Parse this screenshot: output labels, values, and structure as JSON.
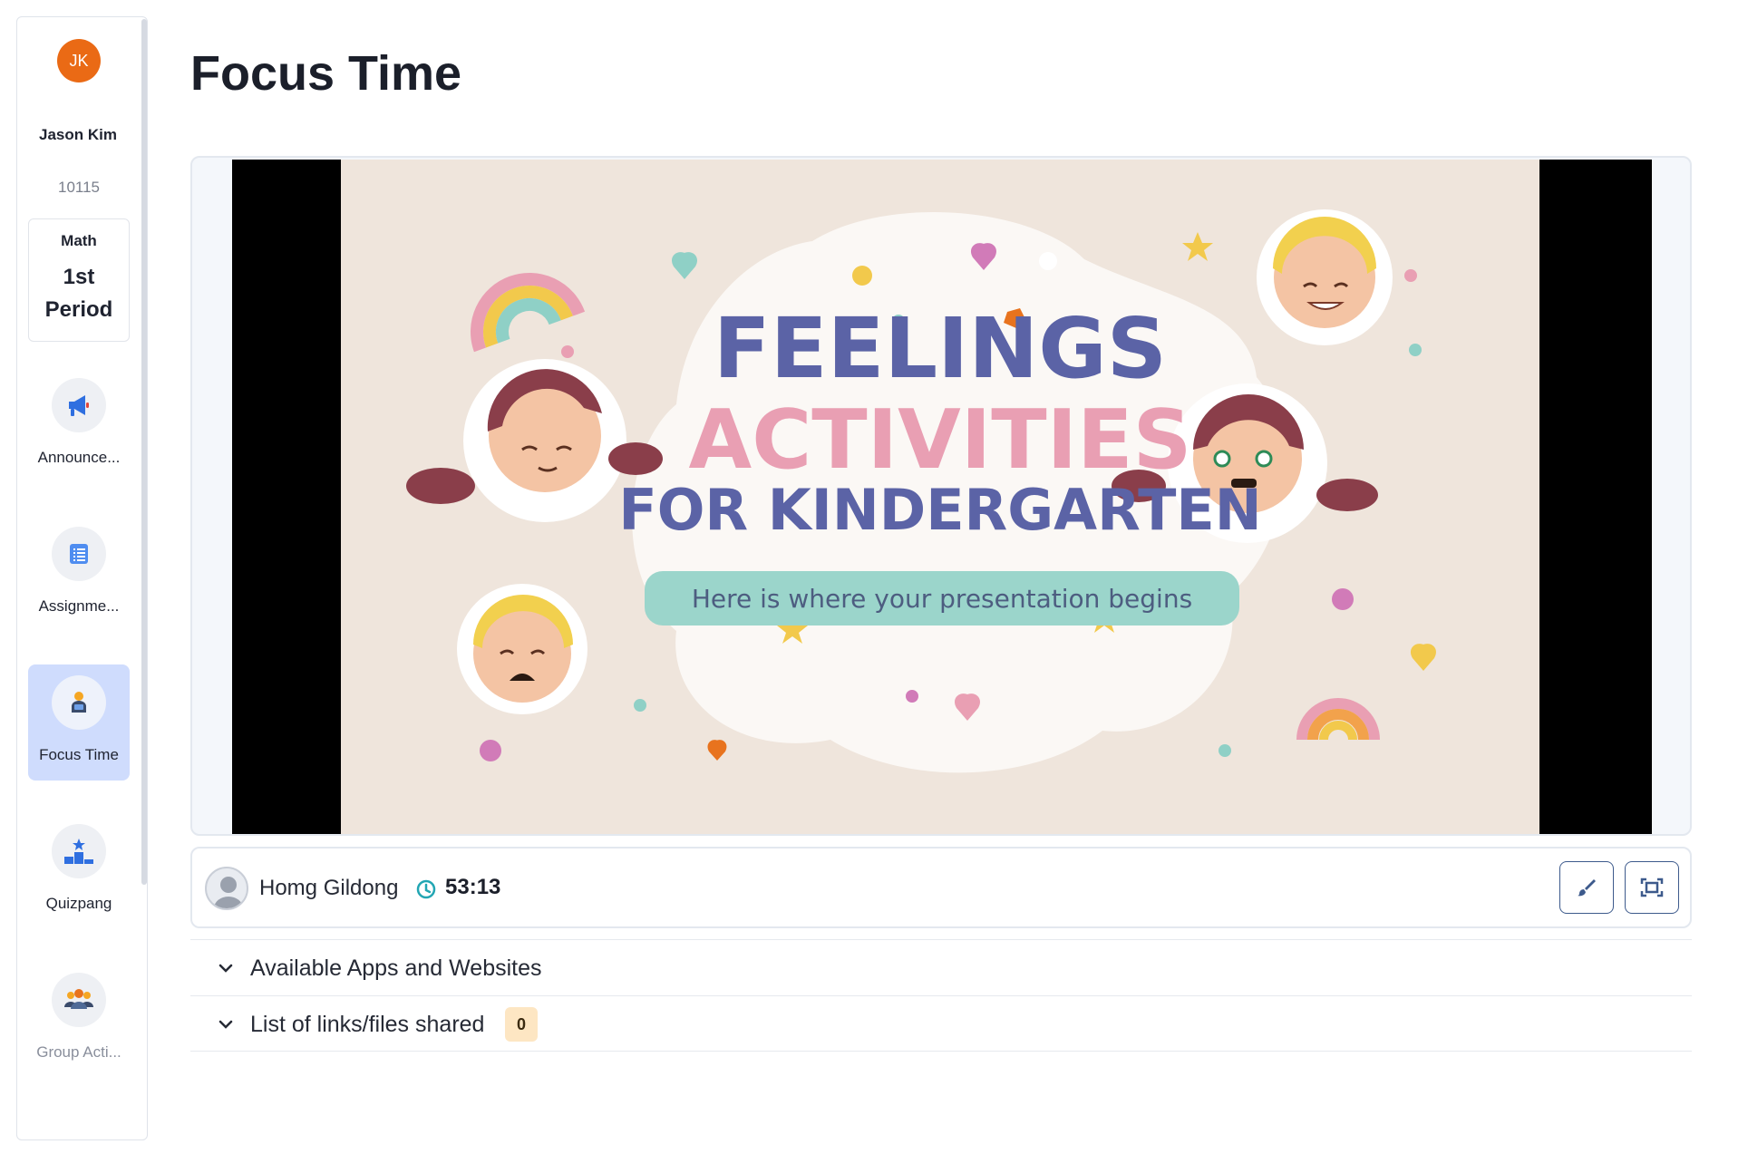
{
  "user": {
    "initials": "JK",
    "name": "Jason Kim",
    "id": "10115",
    "avatar_color": "#ea6a15"
  },
  "class": {
    "subject": "Math",
    "period_line1": "1st",
    "period_line2": "Period"
  },
  "sidebar": {
    "items": [
      {
        "label": "Announce...",
        "icon": "megaphone-icon"
      },
      {
        "label": "Assignme...",
        "icon": "list-icon"
      },
      {
        "label": "Focus Time",
        "icon": "focus-person-icon",
        "active": true
      },
      {
        "label": "Quizpang",
        "icon": "podium-icon"
      },
      {
        "label": "Group Acti...",
        "icon": "group-icon",
        "disabled": true
      }
    ]
  },
  "page": {
    "title": "Focus Time"
  },
  "slide": {
    "line1": "FEELINGS",
    "line2": "ACTIVITIES",
    "line3": "FOR KINDERGARTEN",
    "subtitle": "Here is where your presentation begins"
  },
  "presenter": {
    "name": "Homg Gildong",
    "timer": "53:13"
  },
  "tools": {
    "draw": "brush-icon",
    "fullscreen": "fullscreen-icon"
  },
  "sections": [
    {
      "label": "Available Apps and Websites"
    },
    {
      "label": "List of links/files shared",
      "count": "0"
    }
  ],
  "colors": {
    "accent_active": "#cfdcfd",
    "badge_bg": "#fde6c3",
    "timer_icon": "#22a6b3"
  }
}
